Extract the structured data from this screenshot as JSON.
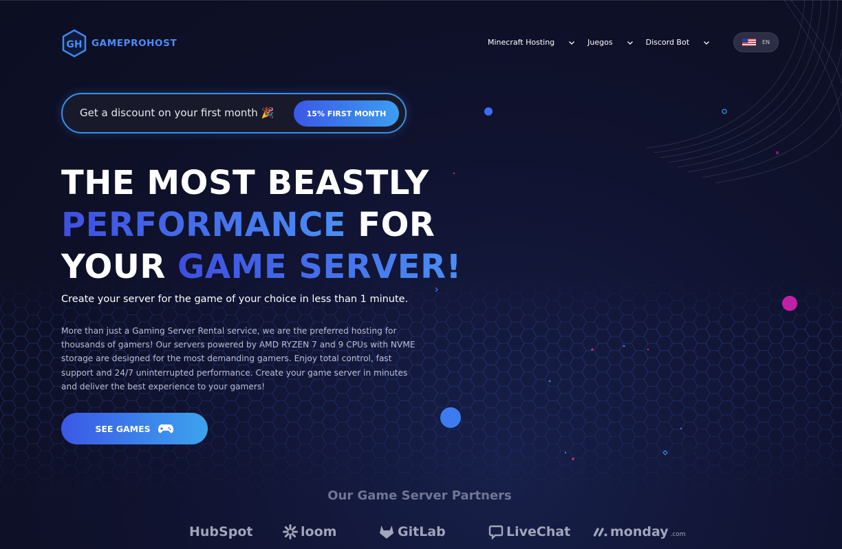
{
  "brand": {
    "name": "GAMEPROHOST",
    "mark_text": "GH",
    "color": "#4b8df6"
  },
  "nav": {
    "items": [
      {
        "label": "Minecraft Hosting",
        "icon": "chevron-down-icon"
      },
      {
        "label": "Juegos",
        "icon": "chevron-down-icon"
      },
      {
        "label": "Discord Bot",
        "icon": "chevron-down-icon"
      }
    ],
    "language": {
      "code": "EN",
      "flag": "us-flag-icon"
    }
  },
  "promo": {
    "text": "Get a discount on your first month 🎉",
    "button_label": "15% FIRST MONTH"
  },
  "hero": {
    "line1": "THE MOST BEASTLY",
    "line2_accent": "PERFORMANCE",
    "line2_rest": " FOR",
    "line3_start": "YOUR ",
    "line3_accent": "GAME SERVER!",
    "subheading": "Create your server for the game of your choice in less than 1 minute.",
    "description": "More than just a Gaming Server Rental service, we are the preferred hosting for thousands of gamers! Our servers powered by AMD RYZEN 7 and 9 CPUs with NVME storage are designed for the most demanding gamers. Enjoy total control, fast support and 24/7 uninterrupted performance. Create your game server in minutes and deliver the best experience to your gamers!",
    "cta_label": "SEE GAMES",
    "cta_icon": "gamepad-icon"
  },
  "partners": {
    "title": "Our Game Server Partners",
    "logos": [
      {
        "name": "HubSpot"
      },
      {
        "name": "loom",
        "icon": "loom-burst-icon"
      },
      {
        "name": "GitLab",
        "icon": "gitlab-fox-icon"
      },
      {
        "name": "LiveChat",
        "icon": "chat-bubble-icon"
      },
      {
        "name": "monday",
        "suffix": ".com",
        "icon": "monday-dots-icon"
      }
    ]
  },
  "colors": {
    "accent_start": "#3b58e6",
    "accent_end": "#3ca3ee",
    "background": "#0e1027"
  }
}
